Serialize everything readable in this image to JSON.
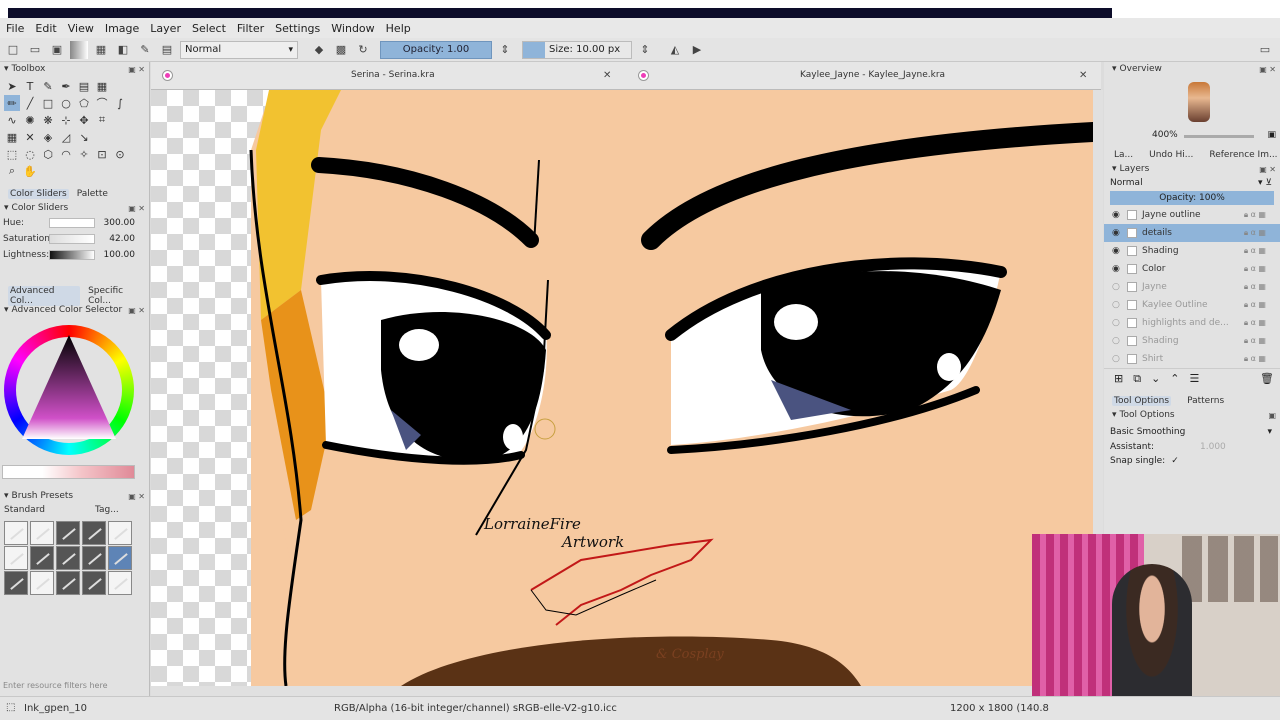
{
  "menu": [
    "File",
    "Edit",
    "View",
    "Image",
    "Layer",
    "Select",
    "Filter",
    "Settings",
    "Window",
    "Help"
  ],
  "toolbar": {
    "blend_mode": "Normal",
    "opacity_label": "Opacity:  1.00",
    "size_label": "Size:  10.00 px"
  },
  "toolbox": {
    "title": "Toolbox"
  },
  "color_panel": {
    "tabs": [
      "Color Sliders",
      "Palette"
    ],
    "title": "Color Sliders",
    "sliders": [
      {
        "label": "Hue:",
        "value": "300.00"
      },
      {
        "label": "Saturation:",
        "value": "42.00"
      },
      {
        "label": "Lightness:",
        "value": "100.00"
      }
    ]
  },
  "selector_panel": {
    "tabs": [
      "Advanced Col...",
      "Specific Col..."
    ],
    "title": "Advanced Color Selector"
  },
  "brush_presets": {
    "title": "Brush Presets",
    "tag_select": "Standard",
    "tag_label": "Tag...",
    "filter_placeholder": "Enter resource filters here"
  },
  "documents": [
    {
      "title": "Serina - Serina.kra"
    },
    {
      "title": "Kaylee_Jayne - Kaylee_Jayne.kra"
    }
  ],
  "canvas": {
    "watermark_line1": "LorraineFire",
    "watermark_line2": "Artwork",
    "watermark_line3": "& Cosplay"
  },
  "overview": {
    "title": "Overview",
    "zoom": "400%"
  },
  "right_tabs": [
    "La...",
    "Undo Hi...",
    "Reference Im..."
  ],
  "layers": {
    "title": "Layers",
    "blend": "Normal",
    "opacity": "Opacity:  100%",
    "items": [
      {
        "name": "Jayne outline",
        "visible": true
      },
      {
        "name": "details",
        "visible": true,
        "selected": true
      },
      {
        "name": "Shading",
        "visible": true
      },
      {
        "name": "Color",
        "visible": true
      },
      {
        "name": "Jayne",
        "visible": false
      },
      {
        "name": "Kaylee Outline",
        "visible": false
      },
      {
        "name": "highlights and de...",
        "visible": false
      },
      {
        "name": "Shading",
        "visible": false
      },
      {
        "name": "Shirt",
        "visible": false
      }
    ]
  },
  "tool_options": {
    "tabs": [
      "Tool Options",
      "Patterns"
    ],
    "title": "Tool Options",
    "smoothing": "Basic Smoothing",
    "assistant_label": "Assistant:",
    "assistant_value": "1.000",
    "snap_label": "Snap single:"
  },
  "status": {
    "brush": "Ink_gpen_10",
    "color_space": "RGB/Alpha (16-bit integer/channel)  sRGB-elle-V2-g10.icc",
    "dimensions": "1200 x 1800 (140.8"
  },
  "colors": {
    "accent": "#8fb4d9",
    "skin": "#f6c9a0",
    "brand_dot": "#ee3eb8"
  }
}
